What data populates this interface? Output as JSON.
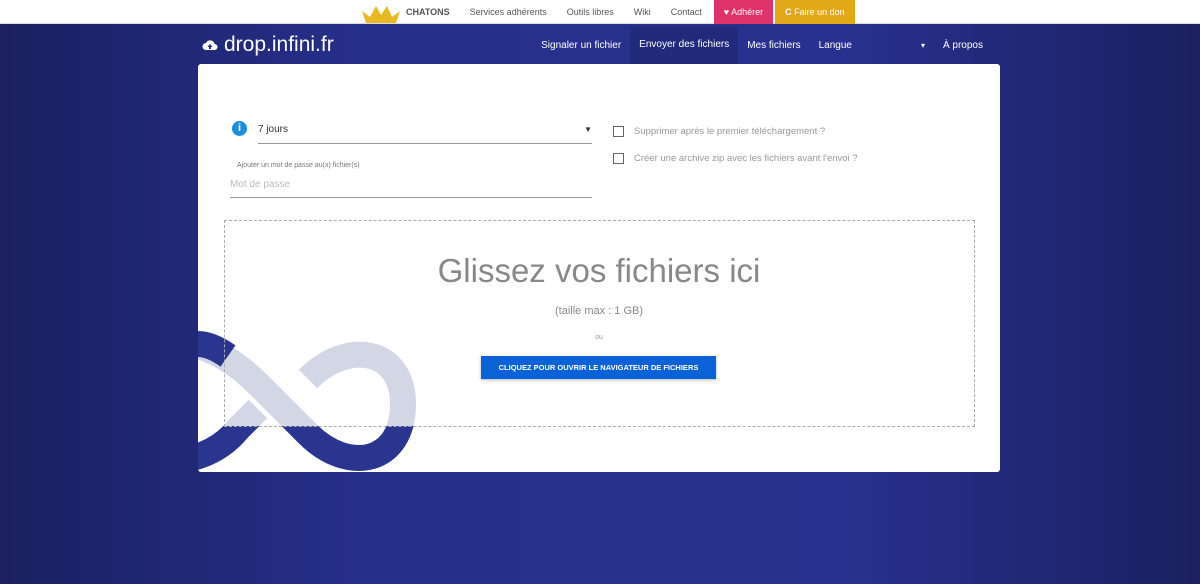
{
  "topbar": {
    "chatons": "CHATONS",
    "services": "Services adhérents",
    "outils": "Outils libres",
    "wiki": "Wiki",
    "contact": "Contact",
    "adherer": "Adhérer",
    "don": "Faire un don"
  },
  "nav": {
    "brand": "drop.infini.fr",
    "items": [
      "Signaler un fichier",
      "Envoyer des fichiers",
      "Mes fichiers",
      "Langue",
      "▾",
      "À propos"
    ]
  },
  "form": {
    "duration": "7 jours",
    "password_label": "Ajouter un mot de passe au(x) fichier(s)",
    "password_placeholder": "Mot de passe",
    "delete_after": "Supprimer après le premier téléchargement ?",
    "zip": "Créer une archive zip avec les fichiers avant l'envoi ?"
  },
  "dropzone": {
    "title": "Glissez vos fichiers ici",
    "max": "(taille max : 1 GB)",
    "or": "ou",
    "button": "CLIQUEZ POUR OUVRIR LE NAVIGATEUR DE FICHIERS"
  },
  "colors": {
    "accent": "#0a62d6",
    "adherer": "#e0316b",
    "don": "#e2a818"
  }
}
